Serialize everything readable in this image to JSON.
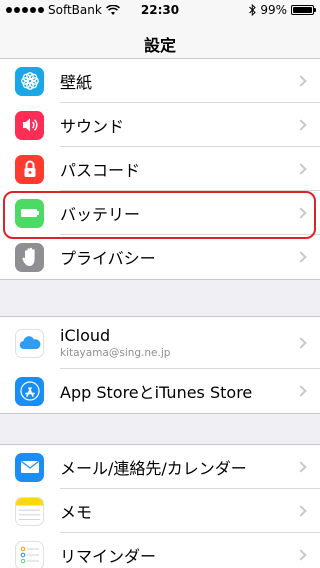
{
  "status_bar": {
    "carrier": "SoftBank",
    "time": "22:30",
    "battery_percent": "99%",
    "battery_level": 0.99,
    "signal_dots": 5
  },
  "nav": {
    "title": "設定"
  },
  "groups": [
    {
      "items": [
        {
          "label": "壁紙",
          "icon": "wallpaper-icon",
          "color": "#1ba6e6"
        },
        {
          "label": "サウンド",
          "icon": "speaker-icon",
          "color": "#fe2d55"
        },
        {
          "label": "パスコード",
          "icon": "lock-icon",
          "color": "#ff3b30"
        },
        {
          "label": "バッテリー",
          "icon": "battery-icon",
          "color": "#4cd964"
        },
        {
          "label": "プライバシー",
          "icon": "hand-icon",
          "color": "#8e8e93"
        }
      ]
    },
    {
      "items": [
        {
          "label": "iCloud",
          "sublabel": "kitayama@sing.ne.jp",
          "icon": "cloud-icon",
          "color": "#ffffff"
        },
        {
          "label": "App StoreとiTunes Store",
          "icon": "app-store-icon",
          "color": "#1a8ef5"
        }
      ]
    },
    {
      "items": [
        {
          "label": "メール/連絡先/カレンダー",
          "icon": "mail-icon",
          "color": "#1a8ef5"
        },
        {
          "label": "メモ",
          "icon": "notes-icon",
          "color": "#ffd60a"
        },
        {
          "label": "リマインダー",
          "icon": "reminders-icon",
          "color": "#ffffff"
        }
      ]
    }
  ]
}
